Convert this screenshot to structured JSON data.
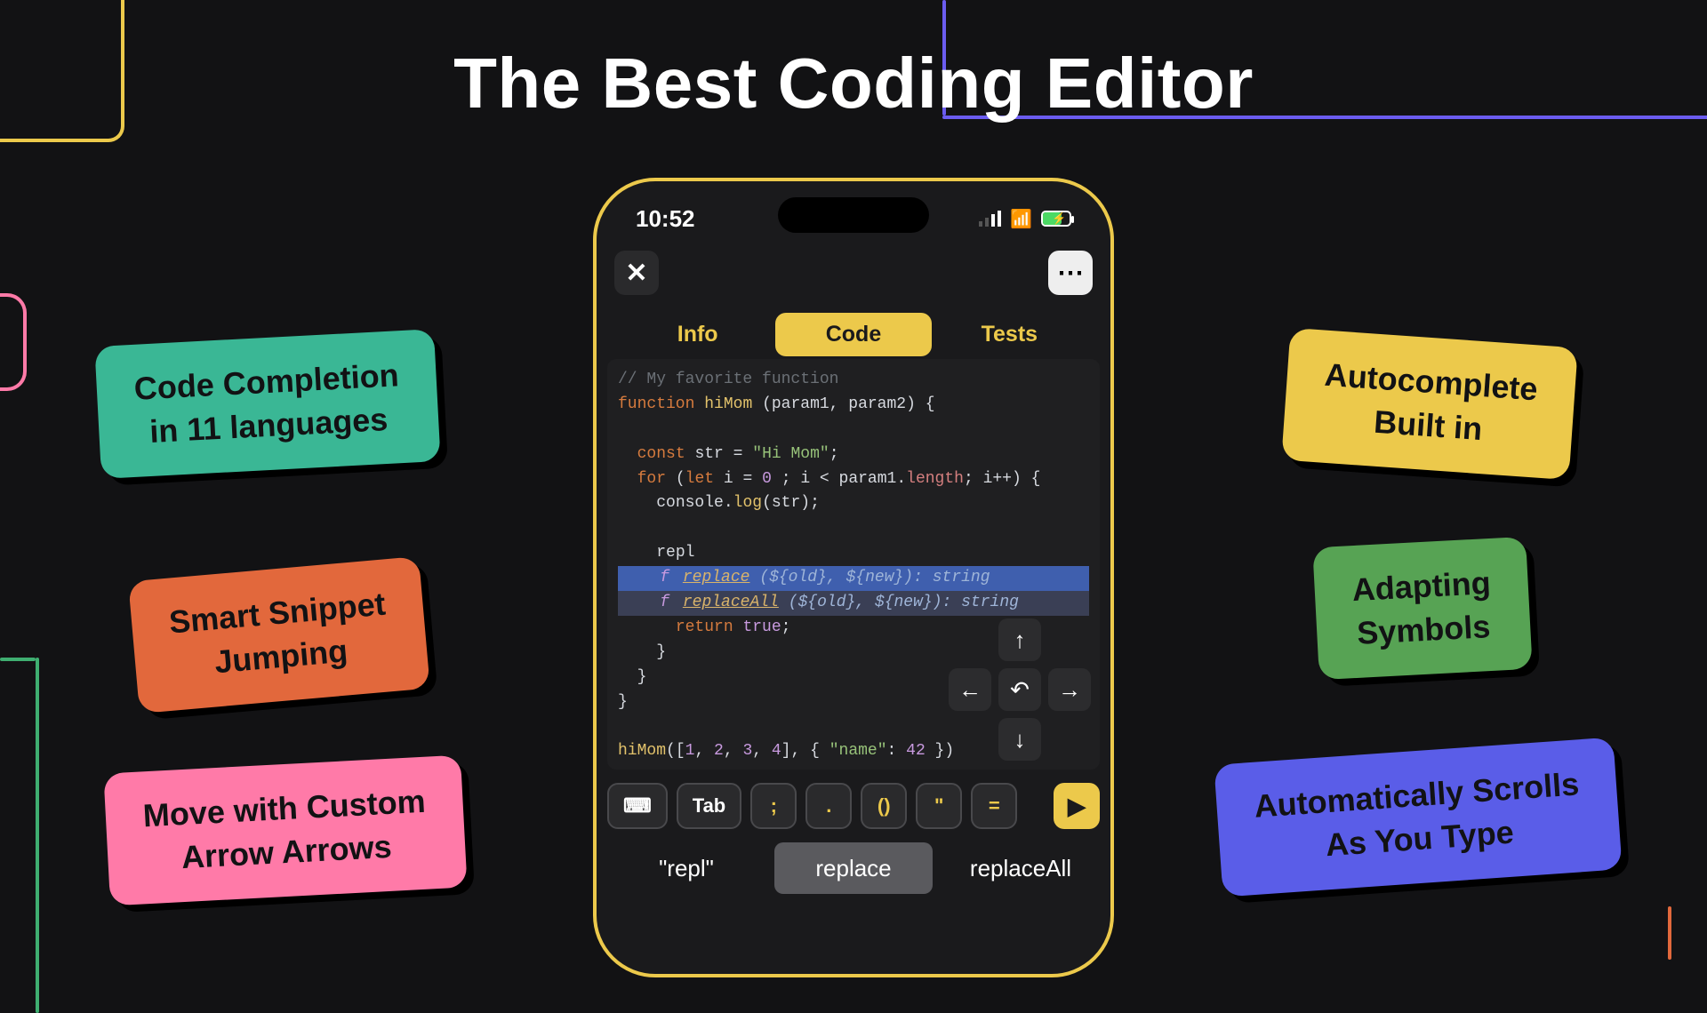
{
  "hero_title": "The Best Coding Editor",
  "callouts": {
    "teal": "Code Completion\nin 11 languages",
    "orange": "Smart Snippet\nJumping",
    "pink": "Move with Custom\nArrow Arrows",
    "yellow": "Autocomplete\nBuilt in",
    "green": "Adapting\nSymbols",
    "purple": "Automatically Scrolls\nAs You Type"
  },
  "phone": {
    "time": "10:52",
    "close_icon": "✕",
    "more_icon": "⋯",
    "tabs": {
      "info": "Info",
      "code": "Code",
      "tests": "Tests"
    },
    "code": {
      "comment": "// My favorite function",
      "fn_kw": "function",
      "fn_name": "hiMom",
      "fn_params": "(param1, param2) {",
      "const_kw": "const",
      "var": "str",
      "eq": "=",
      "str_lit": "\"Hi Mom\"",
      "semi": ";",
      "for_kw": "for",
      "let_kw": "let",
      "i": "i",
      "zero": "0",
      "cond": "; i < param1.",
      "length": "length",
      "inc": "; i++) {",
      "console": "console",
      "dot": ".",
      "log": "log",
      "log_arg": "(str);",
      "typed": "repl",
      "ac1_f": "f",
      "ac1_name": "replace",
      "ac1_sig": " (${old}, ${new}): string",
      "ac2_f": "f",
      "ac2_name": "replaceAll",
      "ac2_sig": " (${old}, ${new}): string",
      "return_kw": "return",
      "true_kw": "true",
      "brace": "}",
      "call_fn": "hiMom",
      "call_open": "([",
      "n1": "1",
      "n2": "2",
      "n3": "3",
      "n4": "4",
      "call_mid": "], { ",
      "key": "\"name\"",
      "colon": ": ",
      "val": "42",
      "call_close": " })"
    },
    "dpad": {
      "up": "↑",
      "down": "↓",
      "left": "←",
      "right": "→",
      "undo": "↶"
    },
    "symbols": {
      "kbd_icon": "⌨",
      "tab": "Tab",
      "semicolon": ";",
      "dot": ".",
      "parens": "()",
      "quote": "\"",
      "equals": "=",
      "play": "▶"
    },
    "suggestions": {
      "s1": "\"repl\"",
      "s2": "replace",
      "s3": "replaceAll"
    }
  }
}
